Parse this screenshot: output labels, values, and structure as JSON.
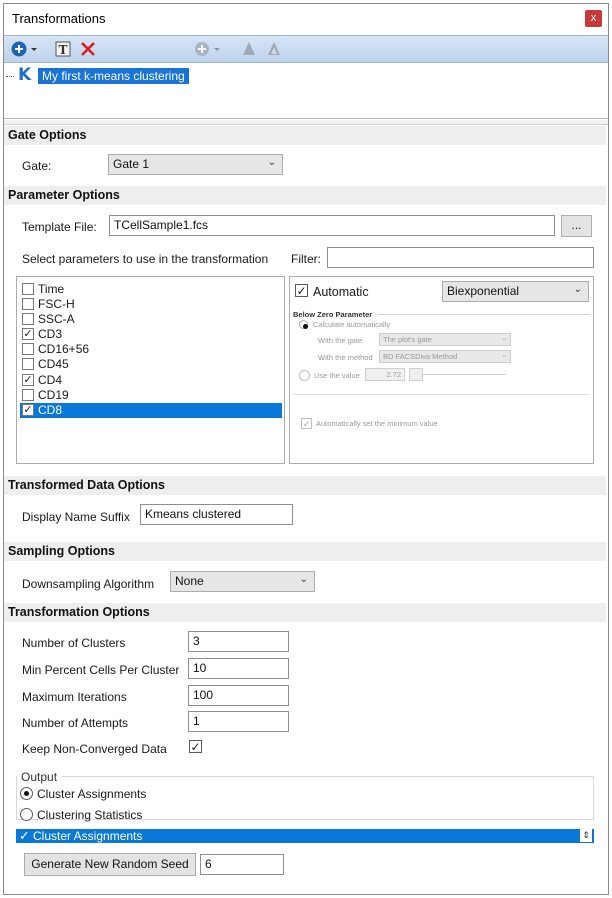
{
  "window": {
    "title": "Transformations",
    "close_glyph": "x"
  },
  "toolbar": {
    "icons": [
      "add-icon",
      "dropdown-arrow-icon",
      "rename-icon",
      "delete-icon",
      "add-disabled-icon",
      "move-up-icon",
      "move-down-icon"
    ]
  },
  "tree": {
    "item_label": "My first k-means clustering",
    "logo_letter": "K"
  },
  "gate_options": {
    "header": "Gate Options",
    "gate_label": "Gate:",
    "gate_value": "Gate 1"
  },
  "parameter_options": {
    "header": "Parameter Options",
    "template_label": "Template File:",
    "template_value": "TCellSample1.fcs",
    "browse_label": "...",
    "select_label": "Select parameters to use in the transformation",
    "filter_label": "Filter:",
    "filter_value": "",
    "parameters": [
      {
        "name": "Time",
        "checked": false,
        "selected": false
      },
      {
        "name": "FSC-H",
        "checked": false,
        "selected": false
      },
      {
        "name": "SSC-A",
        "checked": false,
        "selected": false
      },
      {
        "name": "CD3",
        "checked": true,
        "selected": false
      },
      {
        "name": "CD16+56",
        "checked": false,
        "selected": false
      },
      {
        "name": "CD45",
        "checked": false,
        "selected": false
      },
      {
        "name": "CD4",
        "checked": true,
        "selected": false
      },
      {
        "name": "CD19",
        "checked": false,
        "selected": false
      },
      {
        "name": "CD8",
        "checked": true,
        "selected": true
      }
    ],
    "transform_panel": {
      "automatic_label": "Automatic",
      "automatic_checked": true,
      "transform_type": "Biexponential",
      "below_zero_header": "Below Zero Parameter",
      "calc_auto_label": "Calculate automatically",
      "with_gate_label": "With the gate",
      "with_gate_value": "The plot's gate",
      "with_method_label": "With the method",
      "with_method_value": "BD FACSDiva Method",
      "use_value_label": "Use the value",
      "use_value": "2.72",
      "auto_min_label": "Automatically set the minimum value"
    }
  },
  "transformed_data_options": {
    "header": "Transformed Data Options",
    "suffix_label": "Display Name Suffix",
    "suffix_value": "Kmeans clustered"
  },
  "sampling_options": {
    "header": "Sampling Options",
    "algo_label": "Downsampling Algorithm",
    "algo_value": "None"
  },
  "transformation_options": {
    "header": "Transformation Options",
    "num_clusters_label": "Number of Clusters",
    "num_clusters_value": "3",
    "min_percent_label": "Min Percent Cells Per Cluster",
    "min_percent_value": "10",
    "max_iter_label": "Maximum Iterations",
    "max_iter_value": "100",
    "attempts_label": "Number of Attempts",
    "attempts_value": "1",
    "keep_label": "Keep Non-Converged Data",
    "keep_checked": true,
    "output_label": "Output",
    "output_option_1": "Cluster Assignments",
    "output_option_2": "Clustering Statistics",
    "output_selected_row": "Cluster Assignments",
    "seed_button": "Generate New Random Seed",
    "seed_value": "6"
  },
  "colors": {
    "selection": "#0a78d7",
    "toolbar": "#c7daf0",
    "close": "#c83a3a",
    "delete": "#d81e1e",
    "brand": "#1d6fc3"
  }
}
